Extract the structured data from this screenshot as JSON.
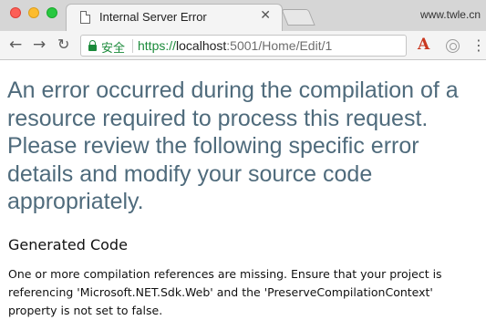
{
  "browser": {
    "tab": {
      "title": "Internal Server Error",
      "close_glyph": "✕",
      "icon": "document-icon"
    },
    "profile_text": "www.twle.cn",
    "nav": {
      "back_glyph": "←",
      "forward_glyph": "→",
      "reload_glyph": "↻"
    },
    "omnibox": {
      "secure_label": "安全",
      "url_scheme": "https://",
      "url_host": "localhost",
      "url_path": ":5001/Home/Edit/1"
    },
    "extensions": {
      "ext_a_label": "A",
      "menu_glyph": "⋮"
    },
    "accent_secure": "#1a8a3a"
  },
  "page": {
    "heading": "An error occurred during the compilation of a resource required to process this request. Please review the following specific error details and modify your source code appropriately.",
    "heading_color": "#4f6b7c",
    "subheading": "Generated Code",
    "message": "One or more compilation references are missing. Ensure that your project is referencing 'Microsoft.NET.Sdk.Web' and the 'PreserveCompilationContext' property is not set to false."
  }
}
